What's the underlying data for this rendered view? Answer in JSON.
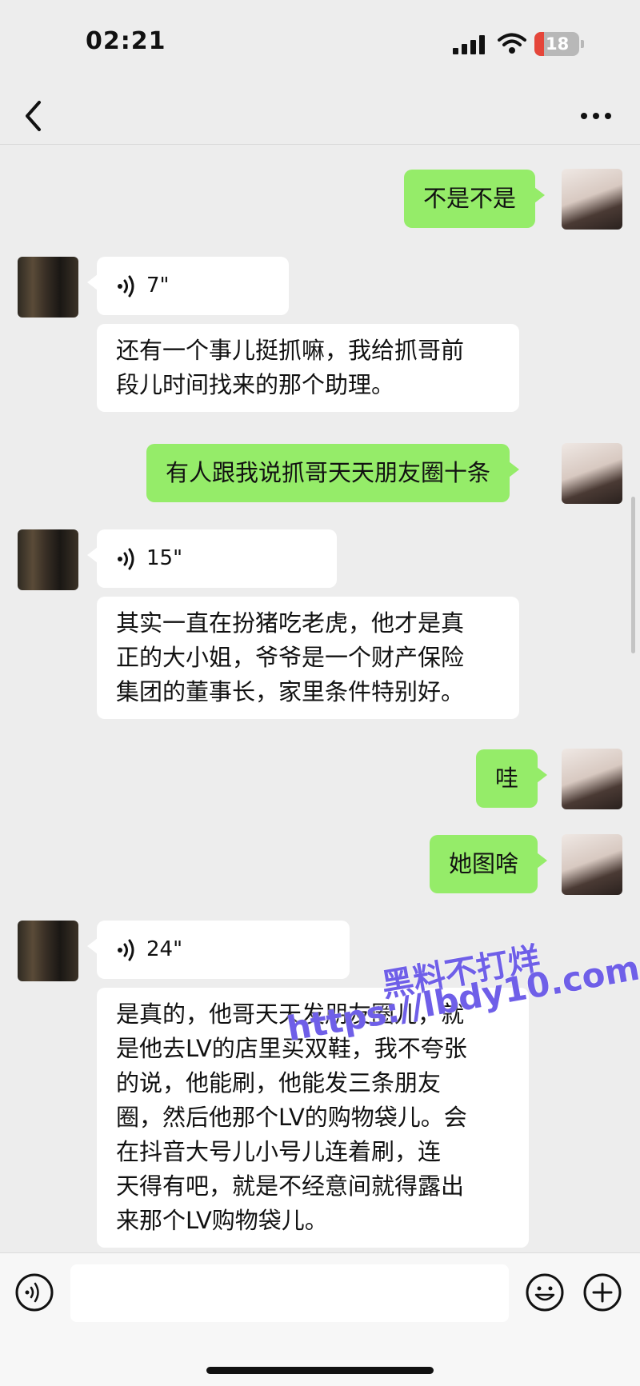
{
  "status_bar": {
    "time": "02:21",
    "battery": "18"
  },
  "nav": {
    "back_icon": "chevron-left-icon",
    "more_icon": "more-horizontal-icon"
  },
  "messages": [
    {
      "side": "right",
      "type": "text",
      "text": "不是不是"
    },
    {
      "side": "left",
      "type": "voice",
      "duration": "7\""
    },
    {
      "side": "left",
      "type": "text",
      "lines": [
        "还有一个事儿挺抓嘛，我给抓哥前",
        "段儿时间找来的那个助理。"
      ]
    },
    {
      "side": "right",
      "type": "text",
      "text": "有人跟我说抓哥天天朋友圈十条"
    },
    {
      "side": "left",
      "type": "voice",
      "duration": "15\""
    },
    {
      "side": "left",
      "type": "text",
      "lines": [
        "其实一直在扮猪吃老虎，他才是真",
        "正的大小姐，爷爷是一个财产保险",
        "集团的董事长，家里条件特别好。"
      ]
    },
    {
      "side": "right",
      "type": "text",
      "text": "哇"
    },
    {
      "side": "right",
      "type": "text",
      "text": "她图啥"
    },
    {
      "side": "left",
      "type": "voice",
      "duration": "24\""
    },
    {
      "side": "left",
      "type": "text",
      "lines": [
        "是真的，他哥天天发朋友圈儿，就",
        "是他去LV的店里买双鞋，我不夸张",
        "的说，他能刷，他能发三条朋友",
        "圈，然后他那个LV的购物袋儿。会",
        "在抖音大号儿小号儿连着刷，连",
        "天得有吧，就是不经意间就得露出",
        "来那个LV购物袋儿。"
      ]
    }
  ],
  "watermark": {
    "line1": "黑料不打烊",
    "line2": "https://lbdy10.com"
  },
  "input_bar": {
    "placeholder": "",
    "voice_icon": "voice-toggle-icon",
    "emoji_icon": "emoji-icon",
    "plus_icon": "plus-icon"
  }
}
